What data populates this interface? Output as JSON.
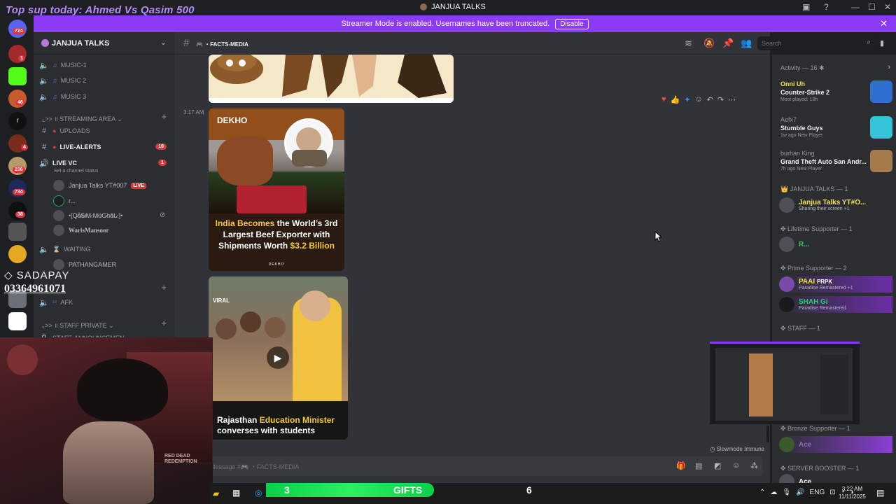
{
  "overlay": {
    "top_text": "Top sup today: Ahmed Vs Qasim 500",
    "sadapay_brand": "SADAPAY",
    "sadapay_number": "03364961071"
  },
  "window": {
    "title": "JANJUA TALKS"
  },
  "banner": {
    "text": "Streamer Mode is enabled. Usernames have been truncated.",
    "disable_label": "Disable"
  },
  "rail": {
    "badges": [
      "724",
      "1",
      "46",
      "4",
      "236",
      "734",
      "38"
    ],
    "letter": "r"
  },
  "sidebar": {
    "guild_name": "JANJUA TALKS",
    "music": [
      "MUSIC-1",
      "MUSIC 2",
      "MUSIC 3"
    ],
    "streaming_category": "STREAMING AREA",
    "uploads": "UPLOADS",
    "live_alerts": "LIVE-ALERTS",
    "live_alerts_count": "10",
    "live_vc": "LIVE VC",
    "live_vc_count": "1",
    "set_status": "Set a channel status",
    "users": {
      "u1": "Janjua Talks YT#007",
      "u1_live": "LIVE",
      "u2": "r...",
      "u3": "•[Q̷å̷$̷i̷M̷.M̷ü̷G̷h̷ã̷L̷.]•",
      "u4": "WarisMansoor"
    },
    "waiting": "WAITING",
    "pathangamer": "PATHANGAMER",
    "afk": "AFK",
    "staff_category": "STAFF PRIVATE",
    "staff_announcements": "STAFF-ANNOUNCEMEN"
  },
  "channel": {
    "name": "FACTS-MEDIA"
  },
  "search": {
    "placeholder": "Search"
  },
  "chat": {
    "timestamp": "3:17 AM",
    "card1": {
      "brand": "DEKHO",
      "headline_hl": "India Becomes",
      "headline_rest": " the World’s 3rd Largest Beef Exporter with Shipments Worth ",
      "headline_hl2": "$3.2 Billion",
      "footer": "DEKHO"
    },
    "card2": {
      "brand": "VIRAL",
      "caption_a": "Rajasthan ",
      "caption_hl": "Education Minister",
      "caption_b": " converses with students"
    },
    "slowmode": "Slowmode Immune",
    "composer_placeholder": "Message #🎮 ・FACTS-MEDIA"
  },
  "members": {
    "activity_head": "Activity — 16",
    "activities": [
      {
        "user": "Onni Uh",
        "game": "Counter-Strike 2",
        "sub": "Most played: 18h"
      },
      {
        "user": "Aefx7",
        "game": "Stumble Guys",
        "sub": "1w ago  New Player"
      },
      {
        "user": "burhan King",
        "game": "Grand Theft Auto San Andr...",
        "sub": "7h ago  New Player"
      }
    ],
    "roles": {
      "janjua": "JANJUA TALKS — 1",
      "lifetime": "Lifetime Supporter — 1",
      "prime": "Prime Supporter — 2",
      "staff": "STAFF — 1",
      "bronze": "Bronze Supporter — 1",
      "booster": "SERVER BOOSTER — 1"
    },
    "list": {
      "janjua_user": "Janjua Talks YT#O...",
      "janjua_sub": "Sharing their screen +1",
      "lifetime_user": "R...",
      "prime1": "PAAI",
      "prime1_tag": "PRPK",
      "prime1_sub": "Paradise Remastered +1",
      "prime2": "SHAH Gi",
      "prime2_sub": "Paradise Remastered",
      "bronze_user": "Ace",
      "booster_user": "Ace"
    }
  },
  "gifts": {
    "left": "3",
    "label": "GIFTS",
    "right": "6"
  },
  "taskbar": {
    "lang": "ENG",
    "time": "3:22 AM",
    "date": "11/11/2025"
  },
  "webcam": {
    "poster_text": "RED DEAD REDEMPTION"
  }
}
